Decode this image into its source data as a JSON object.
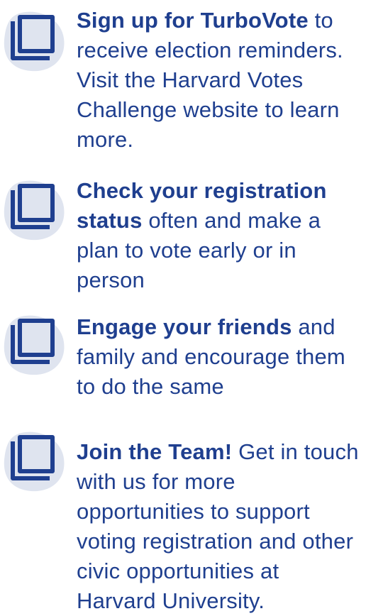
{
  "colors": {
    "text": "#1f3f8f",
    "icon_stroke": "#1f3f8f",
    "icon_blob": "#dfe4ef"
  },
  "icon_name": "copy-squares-icon",
  "items": [
    {
      "bold": "Sign up for TurboVote",
      "rest": " to receive election reminders. Visit the Harvard Votes Challenge website to learn more."
    },
    {
      "bold": "Check your registration status",
      "rest": " often and make a plan  to vote early or in person"
    },
    {
      "bold": "Engage your friends",
      "rest": " and family and encourage them to do the same"
    },
    {
      "bold": "Join the Team!",
      "rest": "  Get in touch with us for more opportunities to support voting registration and other civic opportunities at Harvard University."
    }
  ]
}
